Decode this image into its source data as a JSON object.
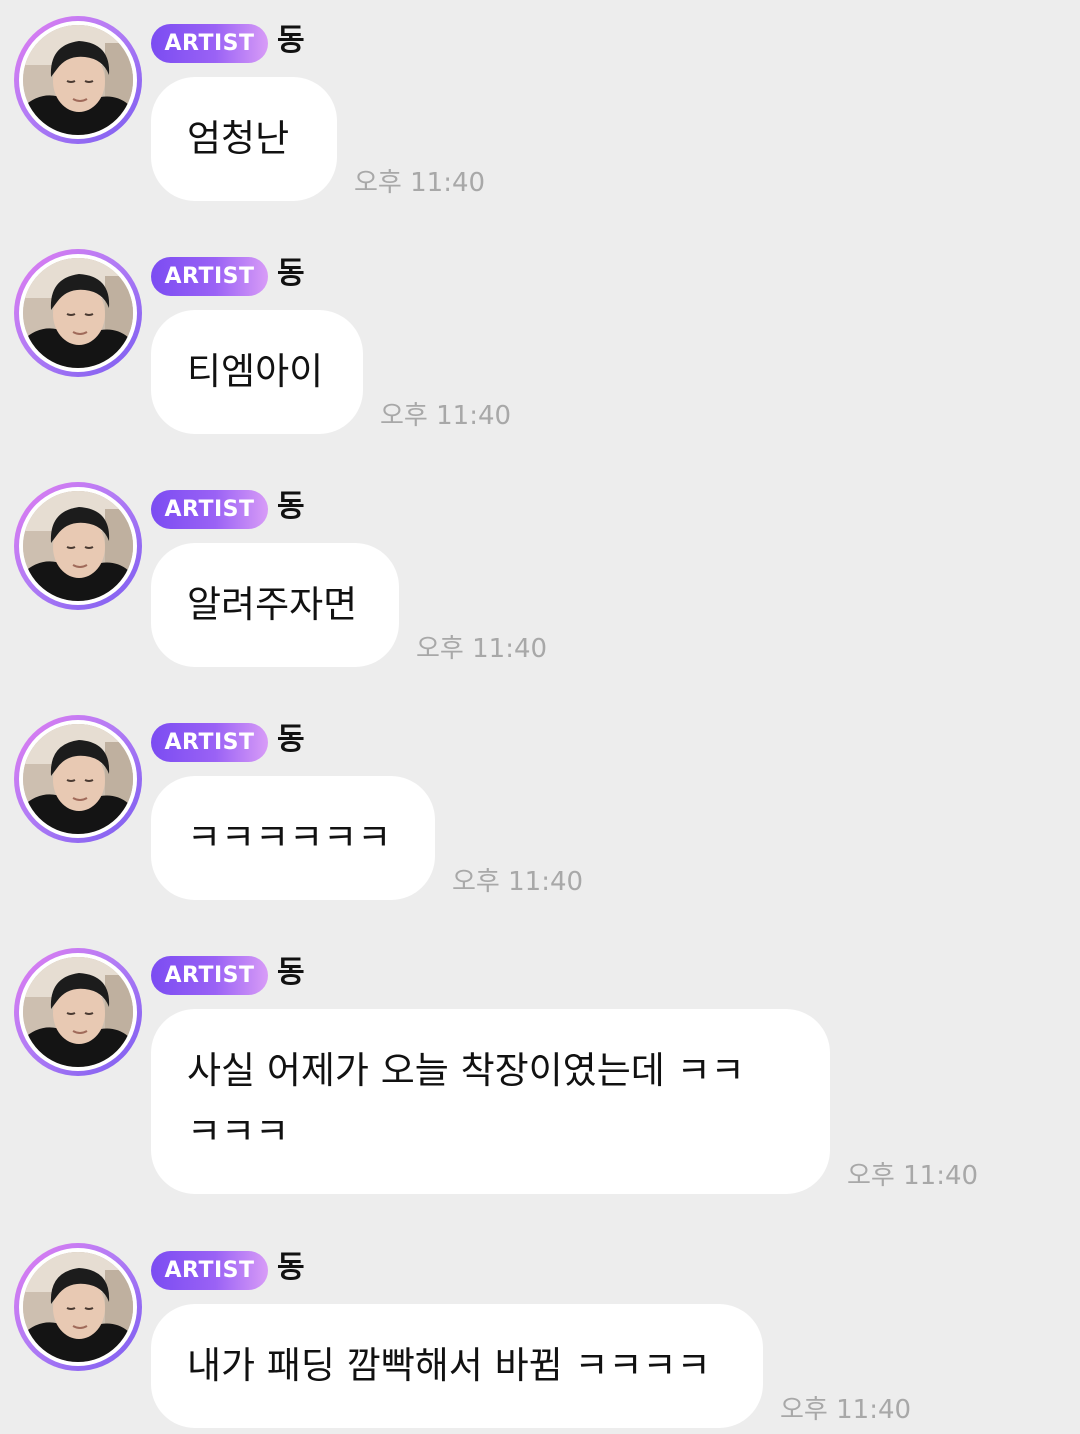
{
  "chat": {
    "badge_label": "ARTIST",
    "sender_name": "동",
    "messages": [
      {
        "text": "엄청난",
        "time": "오후 11:40"
      },
      {
        "text": "티엠아이",
        "time": "오후 11:40"
      },
      {
        "text": "알려주자면",
        "time": "오후 11:40"
      },
      {
        "text": "ㅋㅋㅋㅋㅋㅋ",
        "time": "오후 11:40"
      },
      {
        "text": "사실 어제가 오늘 착장이였는데 ㅋㅋ\nㅋㅋㅋ",
        "time": "오후 11:40"
      },
      {
        "text": "내가 패딩 깜빡해서 바뀜 ㅋㅋㅋㅋ",
        "time": "오후 11:40"
      }
    ]
  },
  "colors": {
    "background": "#ededed",
    "bubble": "#ffffff",
    "badge_start": "#7b4cf2",
    "badge_end": "#d89cf7",
    "time_text": "#a8a8a8"
  },
  "icons": {
    "avatar": "profile-photo"
  }
}
